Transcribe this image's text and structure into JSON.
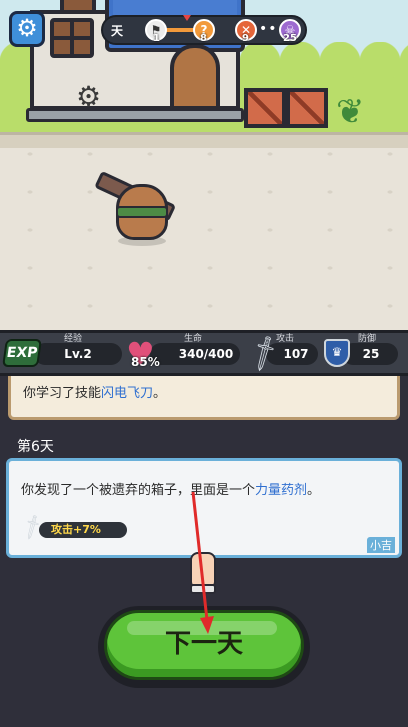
{
  "hud": {
    "day_label": "天",
    "progress_nodes": [
      {
        "icon": "flag-icon",
        "count": "1"
      },
      {
        "icon": "question-icon",
        "count": "8"
      },
      {
        "icon": "battle-icon",
        "count": "9"
      },
      {
        "icon": "skull-icon",
        "count": "25"
      }
    ],
    "dots": "•••"
  },
  "stats": {
    "exp": {
      "icon_text": "EXP",
      "title": "经验",
      "value": "Lv.2"
    },
    "hp": {
      "title": "生命",
      "percent": "85%",
      "value": "340/400"
    },
    "attack": {
      "title": "攻击",
      "value": "107"
    },
    "defense": {
      "title": "防御",
      "value": "25"
    }
  },
  "log": {
    "previous_prefix": "你学习了技能",
    "previous_highlight": "闪电飞刀",
    "previous_suffix": "。",
    "day_heading": "第6天",
    "entry_prefix": "你发现了一个被遗弃的箱子，里面是一个",
    "entry_highlight": "力量药剂",
    "entry_suffix": "。",
    "reward": "攻击+7%",
    "author": "小吉"
  },
  "next_button": {
    "label": "下一天"
  },
  "colors": {
    "highlight": "#2f6fd0",
    "button_green": "#5ec43a",
    "card_border": "#6ab0d9",
    "hp_heart": "#e0507a"
  }
}
